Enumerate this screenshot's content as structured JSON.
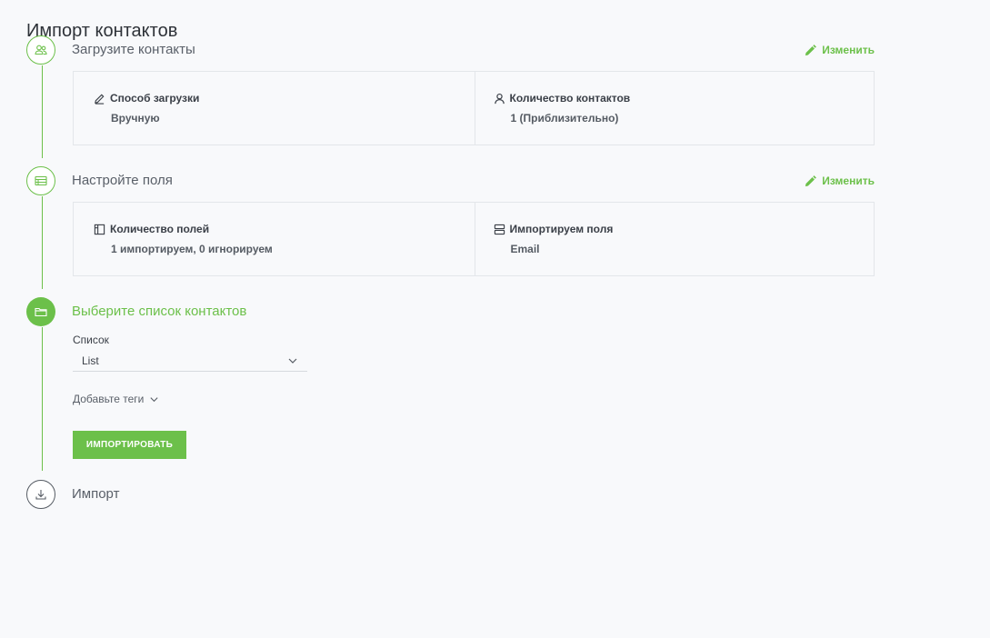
{
  "page": {
    "title": "Импорт контактов"
  },
  "steps": [
    {
      "title": "Загрузите контакты",
      "icon": "users-icon",
      "status": "done",
      "edit_label": "Изменить",
      "card": [
        {
          "label": "Способ загрузки",
          "value": "Вручную",
          "icon": "pencil-icon"
        },
        {
          "label": "Количество контактов",
          "value": "1 (Приблизительно)",
          "icon": "user-icon"
        }
      ]
    },
    {
      "title": "Настройте поля",
      "icon": "table-icon",
      "status": "done",
      "edit_label": "Изменить",
      "card": [
        {
          "label": "Количество полей",
          "value": "1 импортируем, 0 игнорируем",
          "icon": "columns-icon"
        },
        {
          "label": "Импортируем поля",
          "value": "Email",
          "icon": "rows-icon"
        }
      ]
    },
    {
      "title": "Выберите список контактов",
      "icon": "folder-icon",
      "status": "active",
      "list_label": "Список",
      "list_value": "List",
      "tags_label": "Добавьте теги",
      "import_button": "ИМПОРТИРОВАТЬ"
    },
    {
      "title": "Импорт",
      "icon": "download-icon",
      "status": "pending"
    }
  ],
  "colors": {
    "accent": "#6cc04a",
    "text": "#3a3f47",
    "background": "#f8f9fb"
  }
}
